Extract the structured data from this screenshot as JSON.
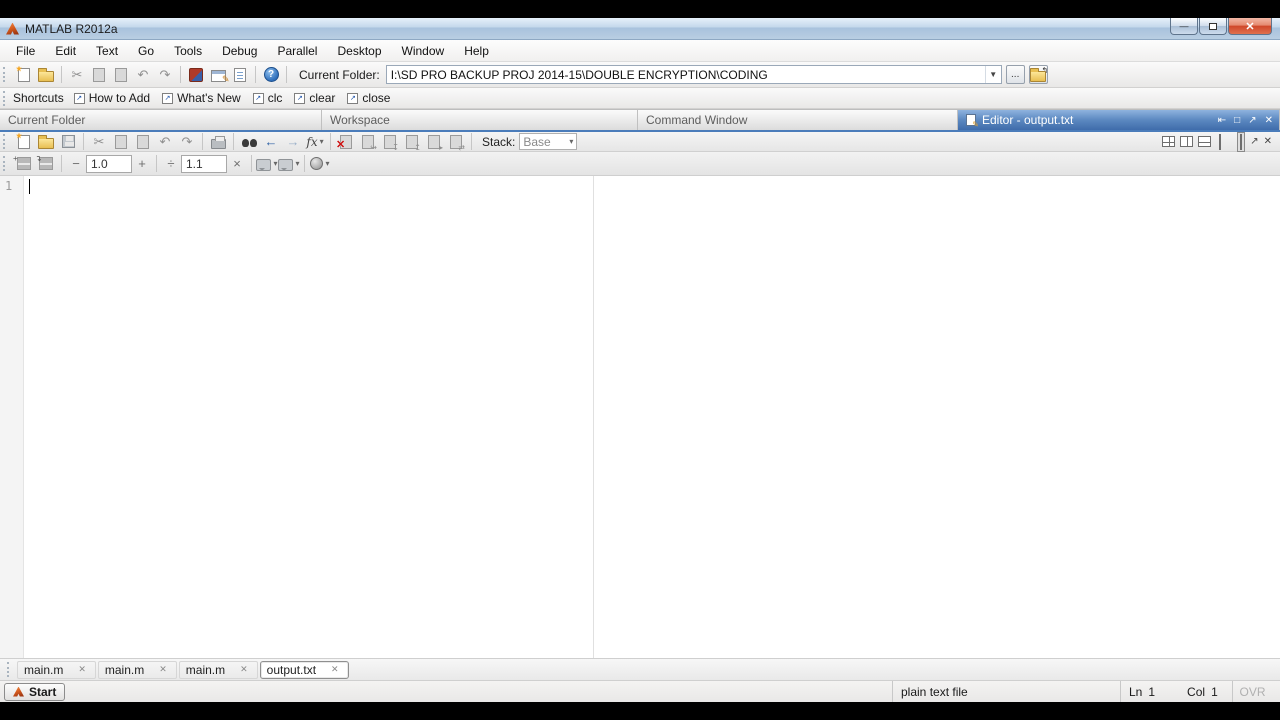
{
  "window": {
    "title": "MATLAB R2012a",
    "controls": {
      "minimize": "—",
      "restore": "❐",
      "close": "✕"
    }
  },
  "menu": {
    "items": [
      "File",
      "Edit",
      "Text",
      "Go",
      "Tools",
      "Debug",
      "Parallel",
      "Desktop",
      "Window",
      "Help"
    ]
  },
  "toolbar": {
    "current_folder_label": "Current Folder:",
    "current_folder_path": "I:\\SD PRO BACKUP PROJ 2014-15\\DOUBLE ENCRYPTION\\CODING",
    "browse_label": "..."
  },
  "shortcuts": {
    "label": "Shortcuts",
    "items": [
      "How to Add",
      "What's New",
      "clc",
      "clear",
      "close"
    ]
  },
  "panel_tabs": [
    {
      "label": "Current Folder",
      "active": false
    },
    {
      "label": "Workspace",
      "active": false
    },
    {
      "label": "Command Window",
      "active": false
    },
    {
      "label": "Editor - output.txt",
      "active": true
    }
  ],
  "editor_toolbar": {
    "stack_label": "Stack:",
    "stack_value": "Base",
    "fx_label": "fx"
  },
  "cell_toolbar": {
    "minus": "−",
    "value1": "1.0",
    "plus": "+",
    "divide": "÷",
    "value2": "1.1",
    "multiply": "×"
  },
  "editor": {
    "line_number": "1",
    "content": ""
  },
  "doc_tabs": [
    {
      "label": "main.m",
      "active": false
    },
    {
      "label": "main.m",
      "active": false
    },
    {
      "label": "main.m",
      "active": false
    },
    {
      "label": "output.txt",
      "active": true
    }
  ],
  "status_bar": {
    "start_label": "Start",
    "file_type": "plain text file",
    "line_label": "Ln",
    "line_value": "1",
    "col_label": "Col",
    "col_value": "1",
    "overwrite_indicator": "OVR"
  },
  "icons": {
    "cut": "✂",
    "undo": "↶",
    "redo": "↷",
    "back": "←",
    "forward": "→",
    "help": "?",
    "dropdown": "▾",
    "combo_arrow": "▼",
    "close": "✕",
    "dock": "⇤",
    "undock": "↗",
    "maximize": "□",
    "folder_up_arrow": "↰",
    "shortcut_arrow": "↗",
    "pencil": "✎"
  },
  "colors": {
    "active_header_blue": "#4a7cba",
    "titlebar_blue": "#b9cee2",
    "close_red": "#cf472a",
    "matlab_orange": "#d55c1e"
  }
}
